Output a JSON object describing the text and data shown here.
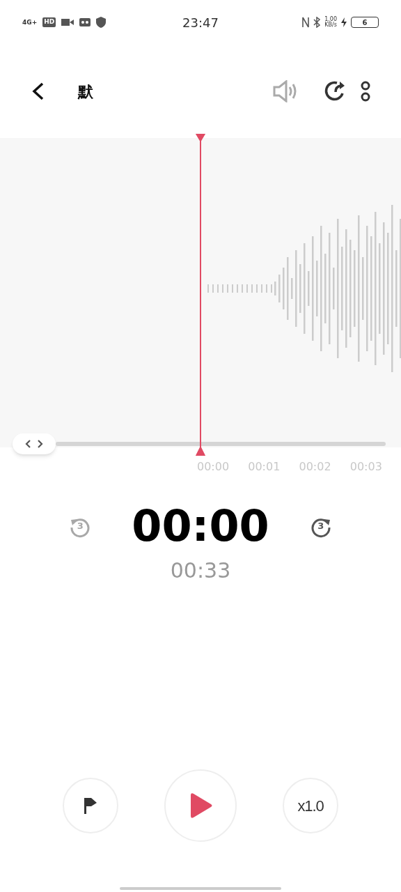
{
  "status_bar": {
    "network": "4G+",
    "hd": "HD",
    "time": "23:47",
    "speed_value": "1.00",
    "speed_unit": "KB/s",
    "battery": "6"
  },
  "header": {
    "title": "默"
  },
  "timeline": {
    "ticks": [
      "00:00",
      "00:01",
      "00:02",
      "00:03"
    ]
  },
  "player": {
    "elapsed": "00:00",
    "duration": "00:33",
    "skip_back": {
      "label": "3",
      "disabled": true
    },
    "skip_forward": {
      "label": "3",
      "disabled": false
    }
  },
  "controls": {
    "speed": "x1.0"
  }
}
